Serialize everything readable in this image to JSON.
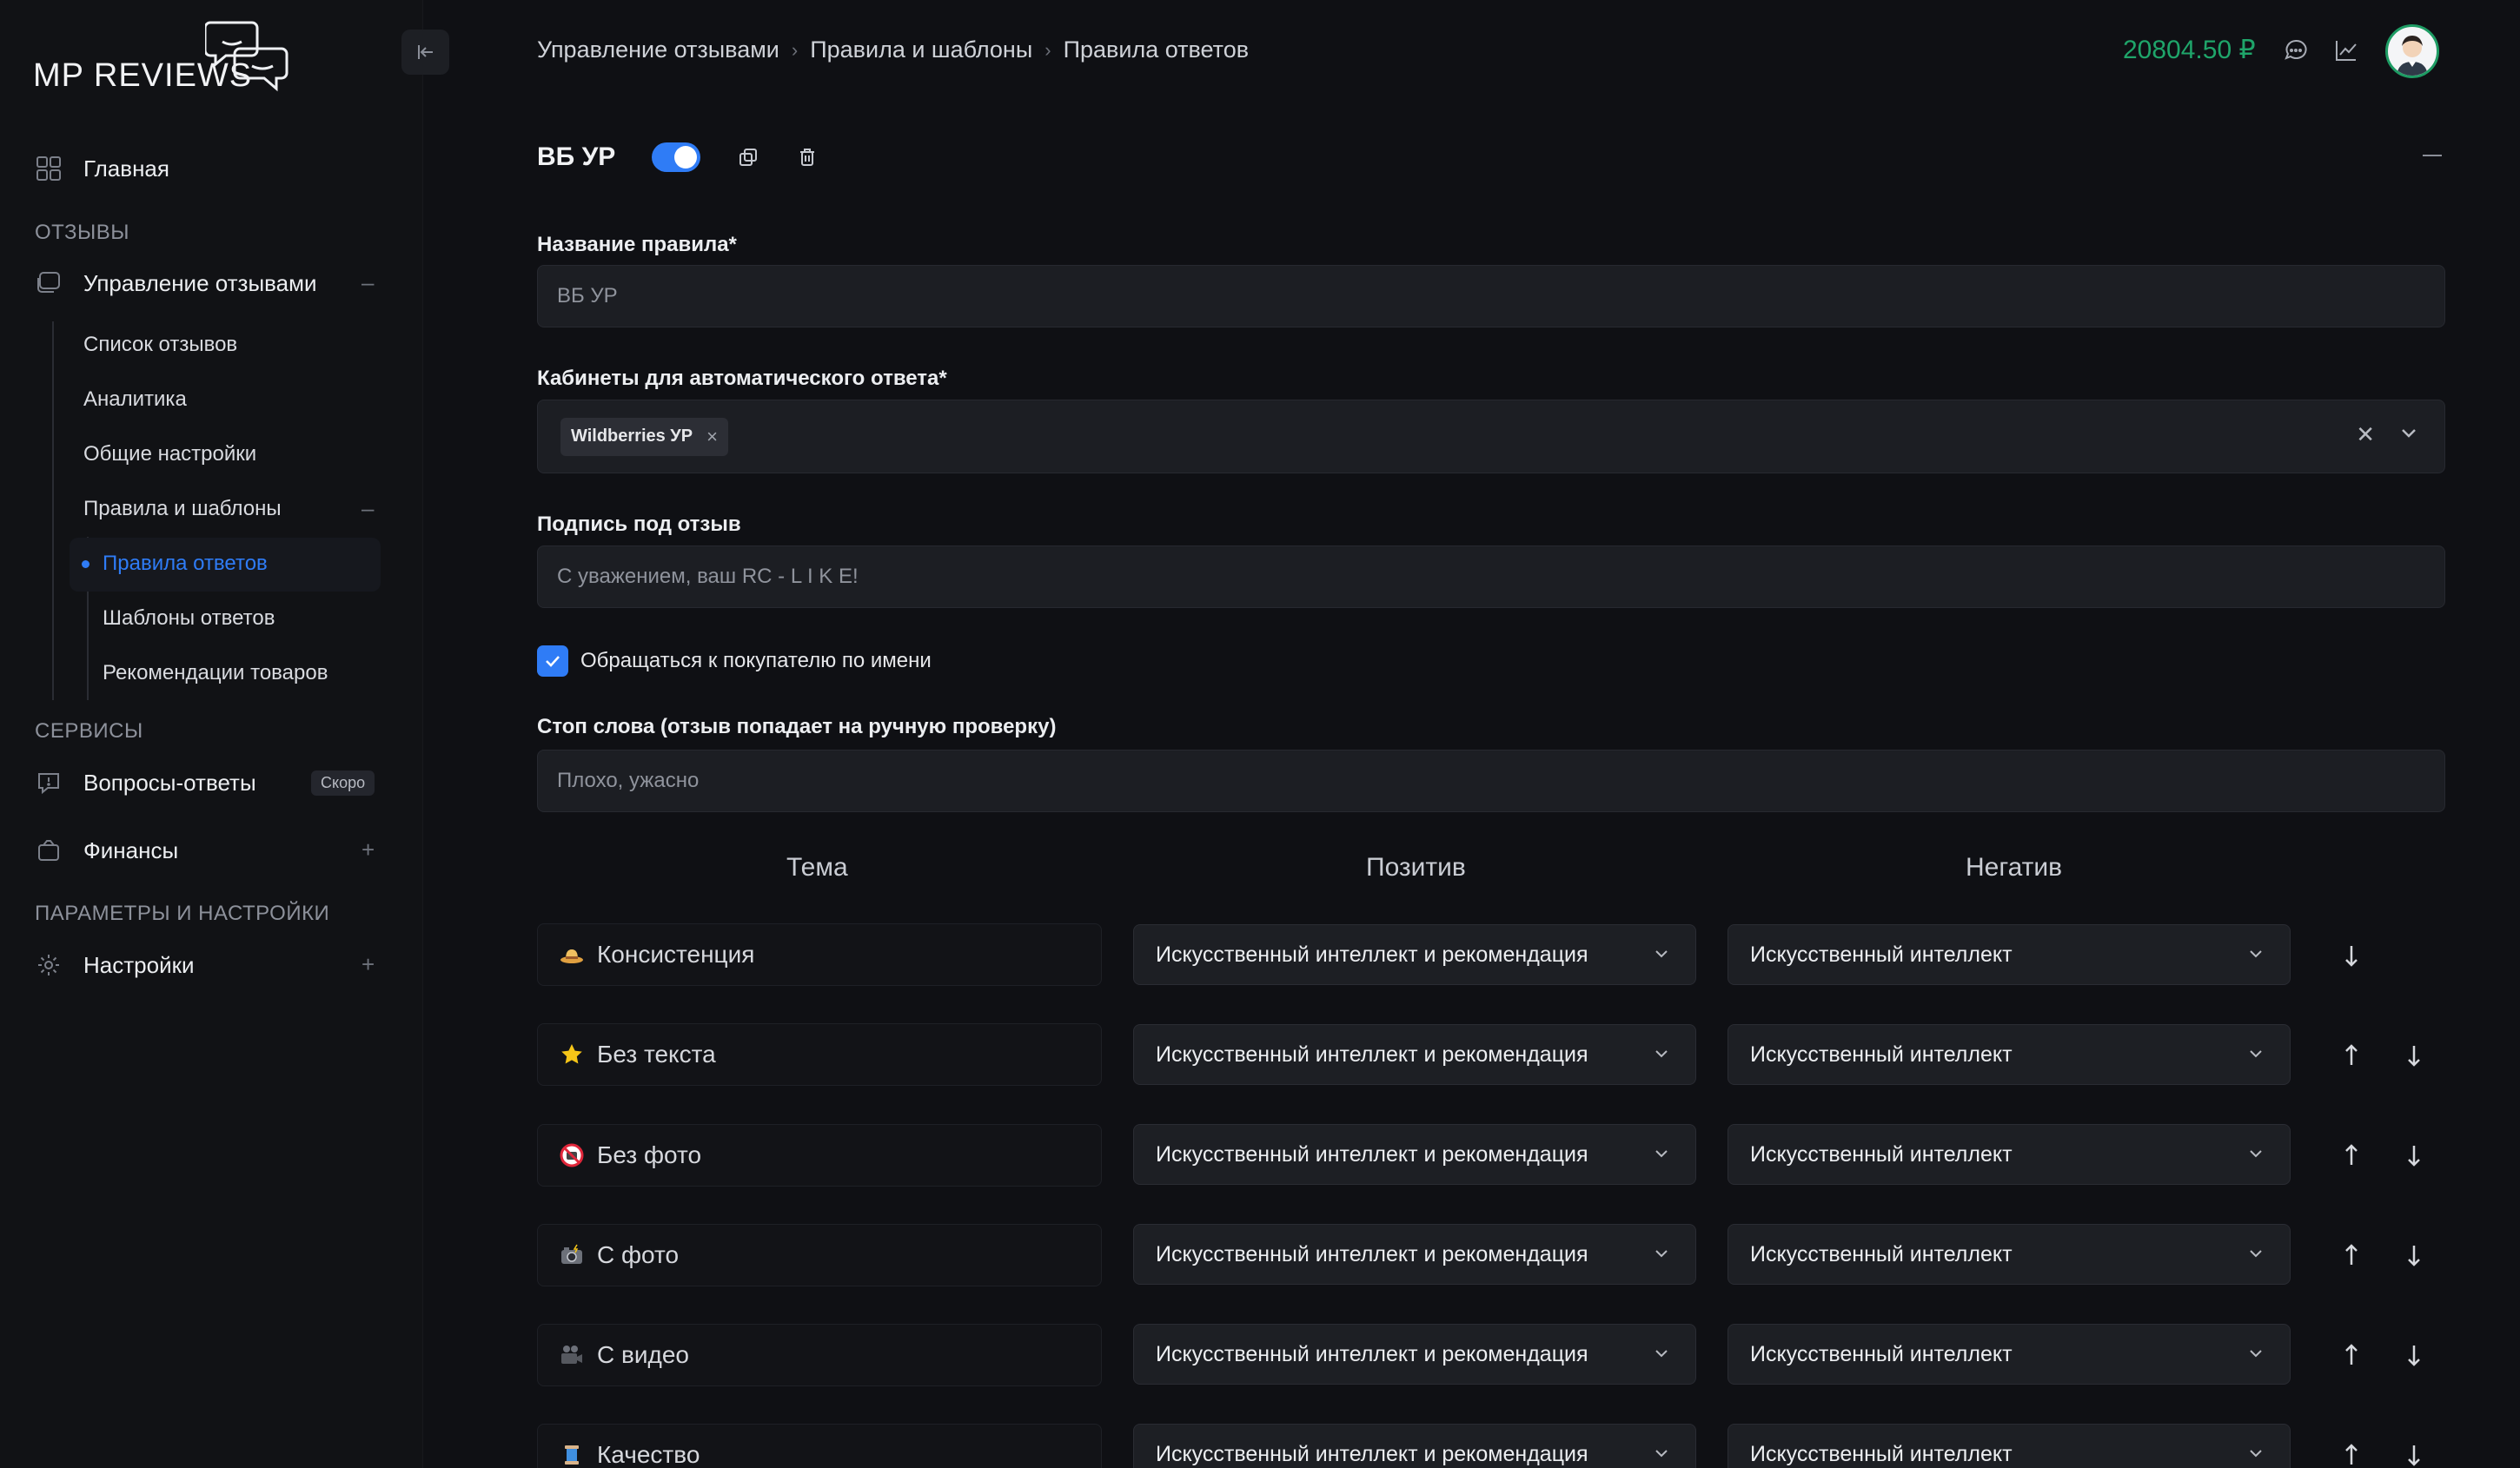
{
  "sidebar": {
    "logo": "MP REVIEWS",
    "home": "Главная",
    "section_reviews": "ОТЗЫВЫ",
    "manage_reviews": "Управление отзывами",
    "reviews_list": "Список отзывов",
    "analytics": "Аналитика",
    "general_settings": "Общие настройки",
    "rules_templates": "Правила и шаблоны",
    "answer_rules": "Правила ответов",
    "answer_templates": "Шаблоны ответов",
    "product_recommendations": "Рекомендации товаров",
    "section_services": "СЕРВИСЫ",
    "qa": "Вопросы-ответы",
    "qa_badge": "Скоро",
    "finances": "Финансы",
    "section_params": "ПАРАМЕТРЫ И НАСТРОЙКИ",
    "settings": "Настройки"
  },
  "header": {
    "breadcrumb": [
      "Управление отзывами",
      "Правила и шаблоны",
      "Правила ответов"
    ],
    "balance": "20804.50 ₽"
  },
  "rule": {
    "title": "ВБ УР",
    "enabled": true
  },
  "form": {
    "name_label": "Название правила*",
    "name_value": "ВБ УР",
    "cabinets_label": "Кабинеты для автоматического ответа*",
    "cabinet_chip": "Wildberries УР",
    "signature_label": "Подпись под отзыв",
    "signature_value": "С уважением, ваш RC - L I K E!",
    "address_by_name_label": "Обращаться к покупателю по имени",
    "address_by_name": true,
    "stopwords_label": "Стоп слова (отзыв попадает на ручную проверку)",
    "stopwords_placeholder": "Плохо, ужасно"
  },
  "table": {
    "col_theme": "Тема",
    "col_positive": "Позитив",
    "col_negative": "Негатив",
    "rows": [
      {
        "theme": "Консистенция",
        "icon": "hat-icon",
        "positive": "Искусственный интеллект и рекомендация",
        "negative": "Искусственный интеллект"
      },
      {
        "theme": "Без текста",
        "icon": "star-icon",
        "positive": "Искусственный интеллект и рекомендация",
        "negative": "Искусственный интеллект"
      },
      {
        "theme": "Без фото",
        "icon": "no-photo-icon",
        "positive": "Искусственный интеллект и рекомендация",
        "negative": "Искусственный интеллект"
      },
      {
        "theme": "С фото",
        "icon": "camera-flash-icon",
        "positive": "Искусственный интеллект и рекомендация",
        "negative": "Искусственный интеллект"
      },
      {
        "theme": "С видео",
        "icon": "movie-camera-icon",
        "positive": "Искусственный интеллект и рекомендация",
        "negative": "Искусственный интеллект"
      },
      {
        "theme": "Качество",
        "icon": "thread-spool-icon",
        "positive": "Искусственный интеллект и рекомендация",
        "negative": "Искусственный интеллект"
      }
    ]
  },
  "colors": {
    "accent": "#2f7cf6",
    "balance": "#1fa56a",
    "background": "#0f1014"
  }
}
